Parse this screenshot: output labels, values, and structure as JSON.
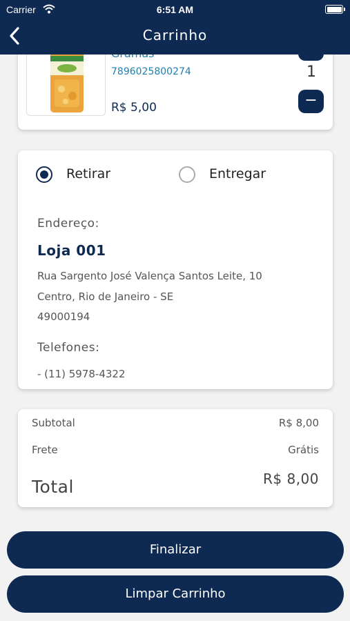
{
  "status_bar": {
    "carrier": "Carrier",
    "time": "6:51 AM"
  },
  "header": {
    "title": "Carrinho"
  },
  "product": {
    "name": "Gramas",
    "code": "7896025800274",
    "price": "R$ 5,00",
    "quantity": "1",
    "plus_label": "+",
    "minus_label": "−"
  },
  "delivery": {
    "options": [
      {
        "label": "Retirar",
        "selected": true
      },
      {
        "label": "Entregar",
        "selected": false
      }
    ],
    "address_label": "Endereço:",
    "store_name": "Loja 001",
    "address_lines": [
      "Rua Sargento José Valença Santos Leite, 10",
      "Centro, Rio de Janeiro - SE",
      "49000194"
    ],
    "phones_label": "Telefones:",
    "phone": "- (11) 5978-4322"
  },
  "totals": {
    "subtotal_label": "Subtotal",
    "subtotal_value": "R$ 8,00",
    "frete_label": "Frete",
    "frete_value": "Grátis",
    "total_label": "Total",
    "total_value": "R$ 8,00"
  },
  "actions": {
    "finalizar_label": "Finalizar",
    "limpar_label": "Limpar Carrinho"
  },
  "colors": {
    "primary": "#0e2a52",
    "link": "#1f7fb0",
    "background": "#f2f2f2"
  }
}
